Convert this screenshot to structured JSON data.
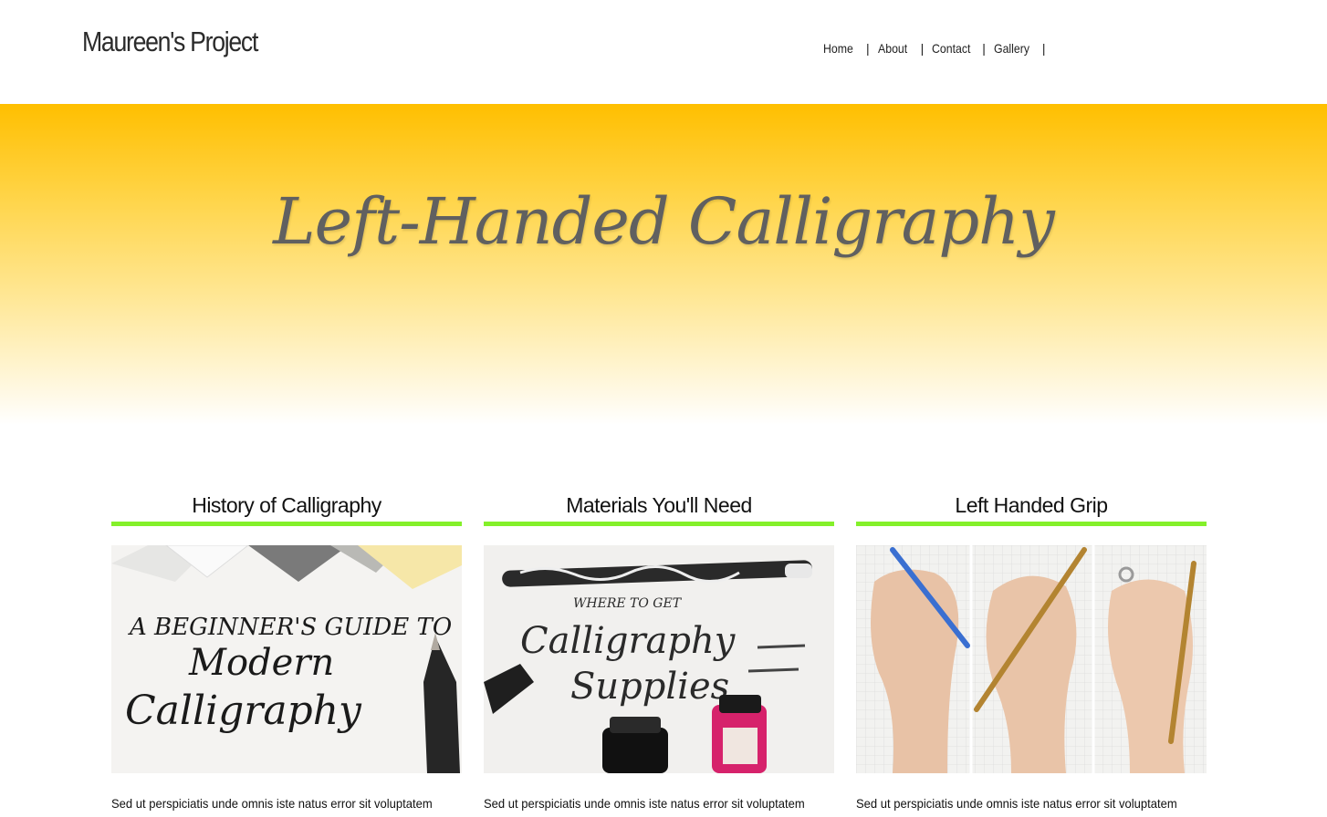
{
  "header": {
    "site_title": "Maureen's Project",
    "nav": [
      {
        "label": "Home"
      },
      {
        "label": "About"
      },
      {
        "label": "Contact"
      },
      {
        "label": "Gallery"
      }
    ],
    "nav_separator": "|"
  },
  "hero": {
    "title": "Left-Handed Calligraphy",
    "gradient_top": "#ffbf00",
    "gradient_bottom": "#ffffff"
  },
  "accent_color": "#84f02a",
  "cards": [
    {
      "heading": "History of Calligraphy",
      "image_text": [
        "A BEGINNER'S GUIDE TO",
        "Modern",
        "Calligraphy"
      ],
      "text": "Sed ut perspiciatis unde omnis iste natus error sit voluptatem"
    },
    {
      "heading": "Materials You'll Need",
      "image_text": [
        "WHERE TO GET",
        "Calligraphy",
        "Supplies"
      ],
      "text": "Sed ut perspiciatis unde omnis iste natus error sit voluptatem"
    },
    {
      "heading": "Left Handed Grip",
      "image_text": [],
      "text": "Sed ut perspiciatis unde omnis iste natus error sit voluptatem"
    }
  ]
}
